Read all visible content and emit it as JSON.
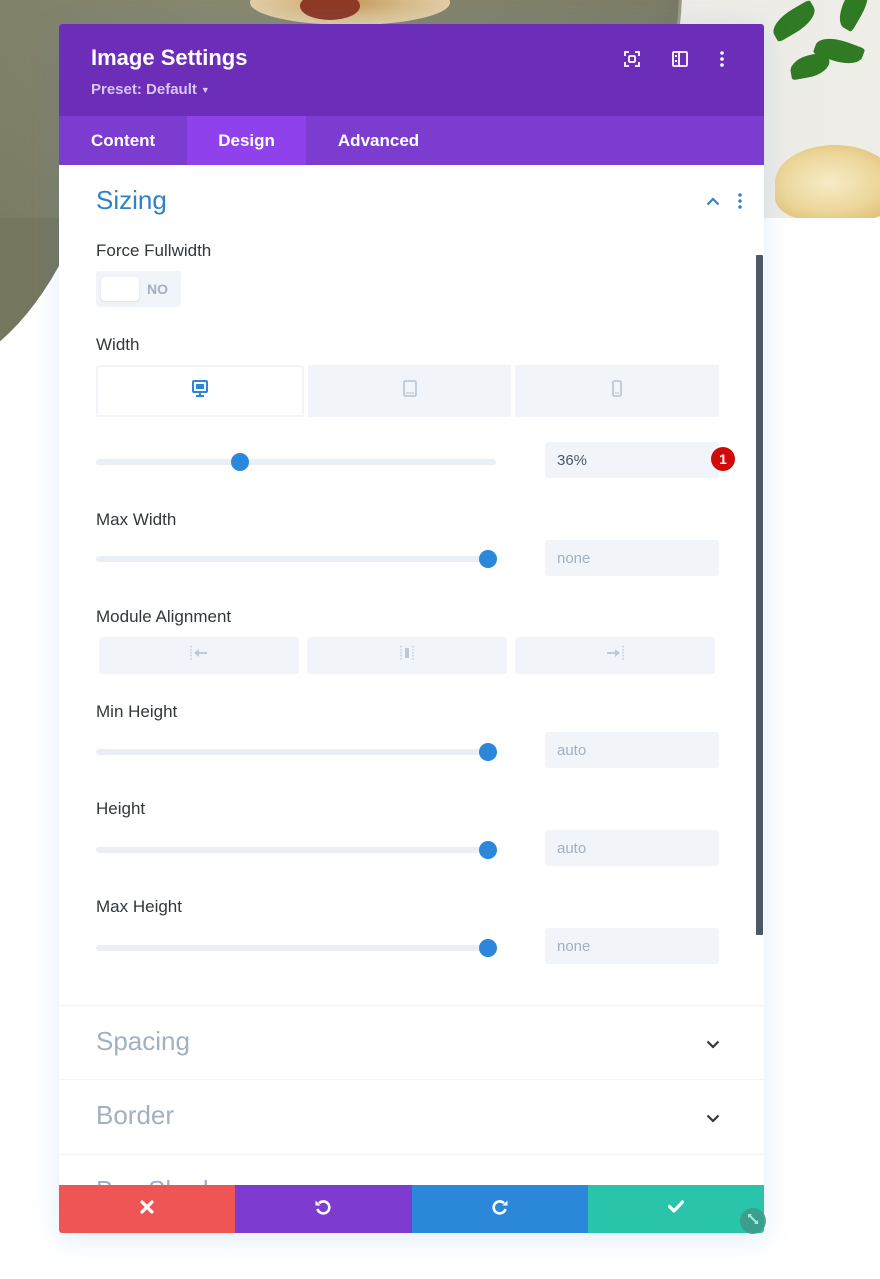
{
  "header": {
    "title": "Image Settings",
    "preset_label": "Preset: Default",
    "icons": [
      "expand-screen-icon",
      "split-view-icon",
      "more-options-icon"
    ]
  },
  "tabs": [
    {
      "label": "Content",
      "active": false
    },
    {
      "label": "Design",
      "active": true
    },
    {
      "label": "Advanced",
      "active": false
    }
  ],
  "sizing": {
    "title": "Sizing",
    "expanded": true,
    "force_fullwidth": {
      "label": "Force Fullwidth",
      "value": "NO",
      "on": false
    },
    "width": {
      "label": "Width",
      "devices": [
        {
          "name": "desktop",
          "icon": "desktop-icon",
          "active": true
        },
        {
          "name": "tablet",
          "icon": "tablet-icon",
          "active": false
        },
        {
          "name": "phone",
          "icon": "phone-icon",
          "active": false
        }
      ],
      "value": "36%",
      "slider_fraction": 0.36,
      "badge": "1"
    },
    "max_width": {
      "label": "Max Width",
      "value": "none",
      "slider_fraction": 0.98
    },
    "module_alignment": {
      "label": "Module Alignment",
      "options": [
        {
          "name": "left",
          "icon": "align-left-icon"
        },
        {
          "name": "center",
          "icon": "align-center-icon"
        },
        {
          "name": "right",
          "icon": "align-right-icon"
        }
      ]
    },
    "min_height": {
      "label": "Min Height",
      "value": "auto",
      "slider_fraction": 0.98
    },
    "height": {
      "label": "Height",
      "value": "auto",
      "slider_fraction": 0.98
    },
    "max_height": {
      "label": "Max Height",
      "value": "none",
      "slider_fraction": 0.98
    }
  },
  "collapsed_sections": [
    {
      "title": "Spacing"
    },
    {
      "title": "Border"
    },
    {
      "title": "Box Shadow"
    }
  ],
  "footer": {
    "buttons": [
      {
        "name": "cancel",
        "icon": "close-icon",
        "color": "#ef5555"
      },
      {
        "name": "undo",
        "icon": "undo-icon",
        "color": "#7e3bd0"
      },
      {
        "name": "redo",
        "icon": "redo-icon",
        "color": "#2b87da"
      },
      {
        "name": "save",
        "icon": "check-icon",
        "color": "#29c4a9"
      }
    ]
  },
  "colors": {
    "header": "#6c2eb9",
    "tab_bar": "#7b3ccf",
    "tab_active": "#8f42ec",
    "accent_blue": "#2b87da",
    "badge_red": "#d20a0a"
  }
}
